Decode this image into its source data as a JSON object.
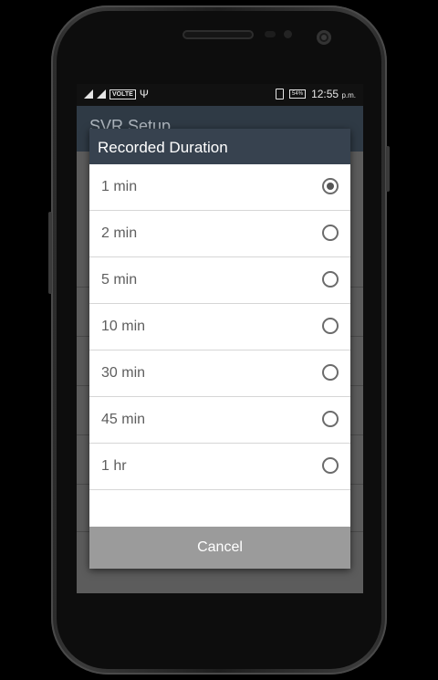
{
  "status_bar": {
    "network_label": "VOLTE",
    "battery_label": "54%",
    "time": "12:55",
    "time_suffix": "p.m."
  },
  "app": {
    "title": "SVR Setup"
  },
  "dialog": {
    "title": "Recorded Duration",
    "selected_index": 0,
    "options": [
      {
        "label": "1 min",
        "selected": true
      },
      {
        "label": "2 min",
        "selected": false
      },
      {
        "label": "5 min",
        "selected": false
      },
      {
        "label": "10 min",
        "selected": false
      },
      {
        "label": "30 min",
        "selected": false
      },
      {
        "label": "45 min",
        "selected": false
      },
      {
        "label": "1 hr",
        "selected": false
      }
    ],
    "cancel_label": "Cancel"
  },
  "icons": [
    "signal-icon",
    "usb-icon",
    "vibrate-icon",
    "battery-icon",
    "radio-selected-icon",
    "radio-unselected-icon"
  ],
  "colors": {
    "dialog_header": "#37424f",
    "cancel_button": "#9b9b9b",
    "screen_dim": "#5c5c5c"
  }
}
